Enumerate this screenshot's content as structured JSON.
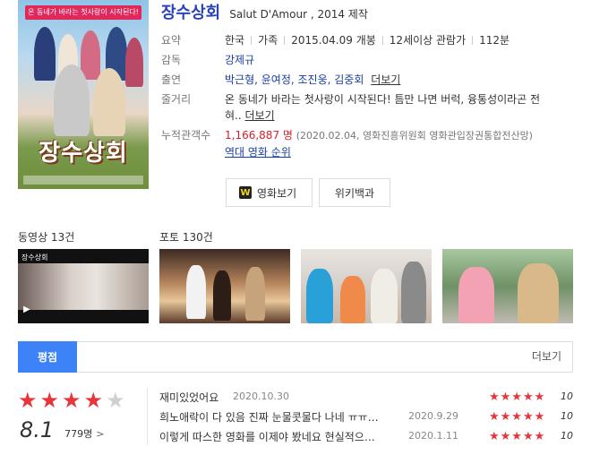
{
  "poster": {
    "tagline": "온 동네가 바라는 첫사랑이 시작된다!",
    "title": "장수상회"
  },
  "header": {
    "title": "장수상회",
    "subtitle": "Salut D'Amour , 2014 제작"
  },
  "info": {
    "summary_label": "요약",
    "summary": {
      "country": "한국",
      "genre": "가족",
      "release": "2015.04.09 개봉",
      "rating": "12세이상 관람가",
      "runtime": "112분"
    },
    "director_label": "감독",
    "director": "강제규",
    "cast_label": "출연",
    "cast": "박근형, 윤여정, 조진웅, 김중회",
    "cast_more": "더보기",
    "plot_label": "줄거리",
    "plot_line1": "온 동네가 바라는 첫사랑이 시작된다! 틈만 나면 버럭, 융통성이라곤 전",
    "plot_line2": "혀..",
    "plot_more": "더보기",
    "audience_label": "누적관객수",
    "audience_count": "1,166,887 명",
    "audience_source": "(2020.02.04, 영화진흥위원회 영화관입장권통합전산망)",
    "ranking_link": "역대 영화 순위"
  },
  "buttons": {
    "watch": "영화보기",
    "watcha_icon": "W",
    "wiki": "위키백과"
  },
  "media": {
    "video_label": "동영상 13건",
    "photo_label": "포토 130건",
    "video_thumb_text": "장수상회"
  },
  "rating": {
    "tab": "평점",
    "more": "더보기",
    "score": "8.1",
    "count": "779명",
    "star_fill": 4,
    "star_total": 5,
    "colors": {
      "star_on": "#e8353c",
      "star_off": "#d0d0d0",
      "tab_bg": "#3d82f6"
    }
  },
  "reviews": [
    {
      "text": "재미있었어요",
      "date": "2020.10.30",
      "stars": "★★★★★",
      "score": "10"
    },
    {
      "text": "희노애락이 다 있음 진짜 눈물콧물다 나네 ㅠㅠ…",
      "date": "2020.9.29",
      "stars": "★★★★★",
      "score": "10"
    },
    {
      "text": "이렇게 따스한 영화를 이제야 봤네요 현실적으…",
      "date": "2020.1.11",
      "stars": "★★★★★",
      "score": "10"
    }
  ]
}
